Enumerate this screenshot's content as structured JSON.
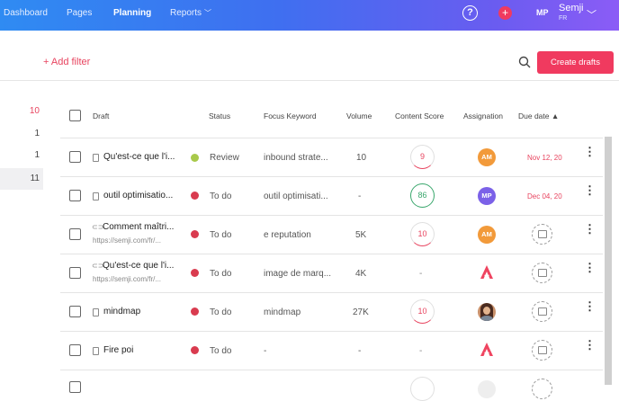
{
  "nav": {
    "dashboard": "Dashboard",
    "pages": "Pages",
    "planning": "Planning",
    "reports": "Reports",
    "help": "?",
    "plus": "+",
    "avatar": "MP",
    "user": "Semji",
    "lang": "FR"
  },
  "toolbar": {
    "add_filter": "+ Add filter",
    "create": "Create drafts"
  },
  "counters": [
    "10",
    "1",
    "1",
    "11"
  ],
  "headers": {
    "draft": "Draft",
    "status": "Status",
    "keyword": "Focus Keyword",
    "volume": "Volume",
    "score": "Content Score",
    "assignation": "Assignation",
    "due": "Due date ▲"
  },
  "rows": [
    {
      "title": "Qu'est-ce que l'i...",
      "url": "",
      "icon": "document-icon",
      "status": "Review",
      "status_color": "#a8c94a",
      "keyword": "inbound strate...",
      "volume": "10",
      "score": "9",
      "score_color": "#e8445f",
      "assign": "AM",
      "assign_color": "#f29a3a",
      "due": "Nov 12, 20"
    },
    {
      "title": "outil optimisatio...",
      "url": "",
      "icon": "document-icon",
      "status": "To do",
      "status_color": "#d93b4f",
      "keyword": "outil optimisati...",
      "volume": "-",
      "score": "86",
      "score_color": "#3aa76d",
      "assign": "MP",
      "assign_color": "#7b61e8",
      "due": "Dec 04, 20"
    },
    {
      "title": "Comment maîtri...",
      "url": "https://semji.com/fr/...",
      "icon": "link-icon",
      "status": "To do",
      "status_color": "#d93b4f",
      "keyword": "e reputation",
      "volume": "5K",
      "score": "10",
      "score_color": "#e8445f",
      "assign": "AM",
      "assign_color": "#f29a3a",
      "due": ""
    },
    {
      "title": "Qu'est-ce que l'i...",
      "url": "https://semji.com/fr/...",
      "icon": "link-icon",
      "status": "To do",
      "status_color": "#d93b4f",
      "keyword": "image de marq...",
      "volume": "4K",
      "score": "-",
      "score_color": "#888888",
      "assign": "",
      "assign_color": "",
      "due": ""
    },
    {
      "title": "mindmap",
      "url": "",
      "icon": "document-icon",
      "status": "To do",
      "status_color": "#d93b4f",
      "keyword": "mindmap",
      "volume": "27K",
      "score": "10",
      "score_color": "#e8445f",
      "assign": "",
      "assign_color": "",
      "due": ""
    },
    {
      "title": "Fire poi",
      "url": "",
      "icon": "document-icon",
      "status": "To do",
      "status_color": "#d93b4f",
      "keyword": "-",
      "volume": "-",
      "score": "-",
      "score_color": "#888888",
      "assign": "",
      "assign_color": "",
      "due": ""
    }
  ]
}
